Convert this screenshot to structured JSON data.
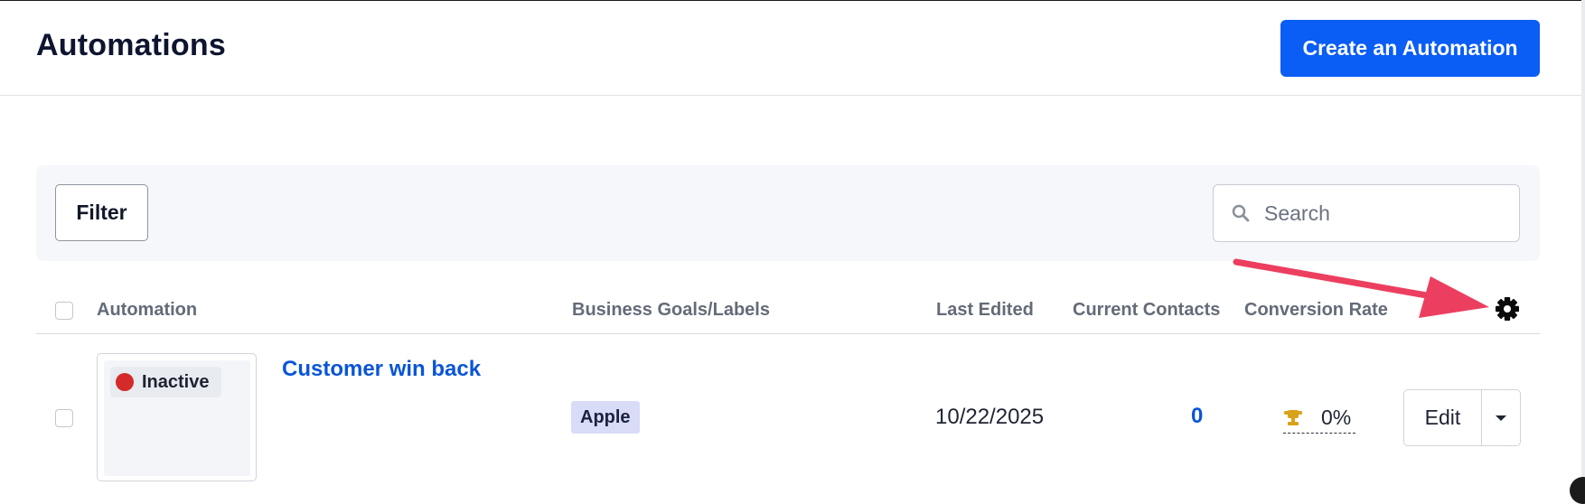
{
  "header": {
    "title": "Automations",
    "create_button_label": "Create an Automation"
  },
  "toolbar": {
    "filter_label": "Filter",
    "search": {
      "placeholder": "Search",
      "value": ""
    }
  },
  "table": {
    "columns": [
      "Automation",
      "Business Goals/Labels",
      "Last Edited",
      "Current Contacts",
      "Conversion Rate"
    ],
    "settings_icon": "gear-icon",
    "rows": [
      {
        "status": "Inactive",
        "status_color": "#d42a2a",
        "name": "Customer win back",
        "label": "Apple",
        "last_edited": "10/22/2025",
        "current_contacts": "0",
        "conversion_rate": "0%",
        "conversion_icon": "trophy-icon",
        "edit_label": "Edit"
      }
    ]
  },
  "colors": {
    "primary": "#0a5df5",
    "link": "#0a55d8",
    "annotation_arrow": "#ec3f5f",
    "label_chip": "#d9dcf7",
    "trophy": "#d9a21b"
  }
}
